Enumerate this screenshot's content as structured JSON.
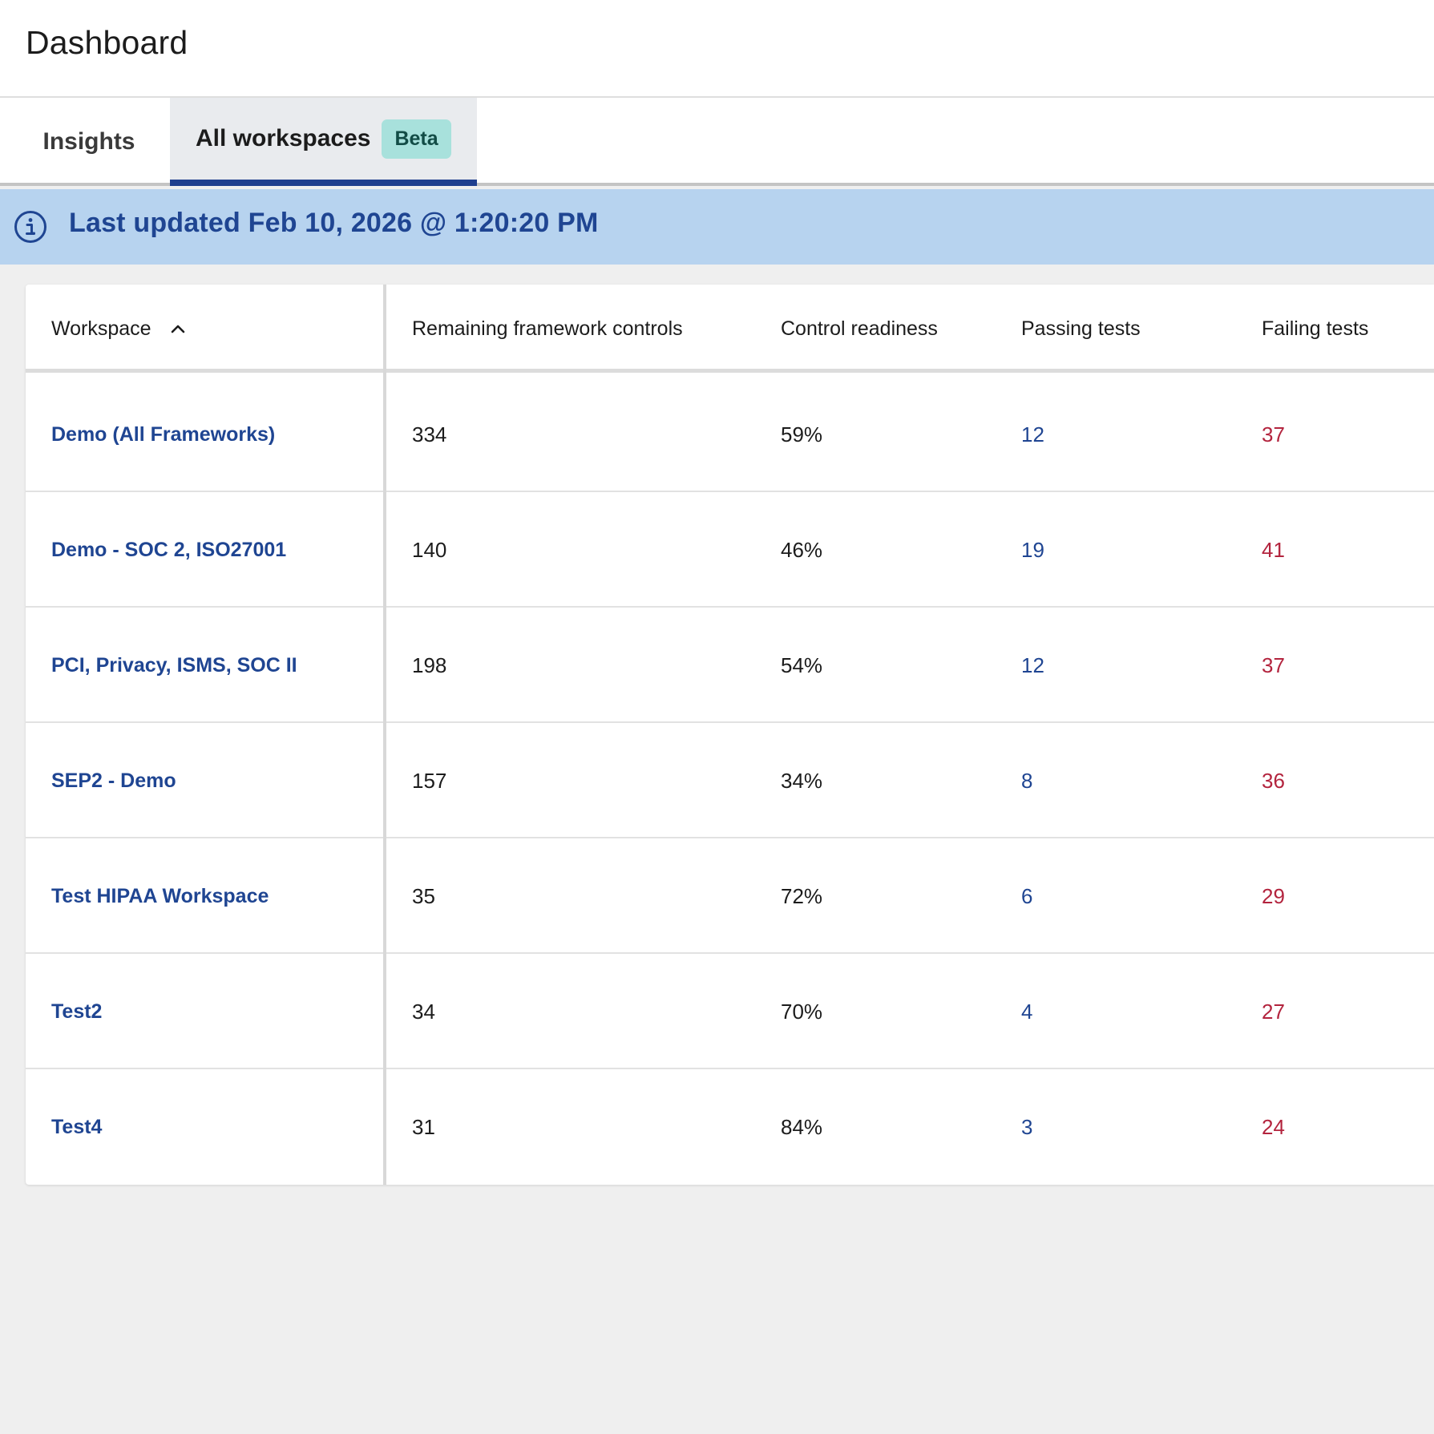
{
  "header": {
    "title": "Dashboard"
  },
  "tabs": [
    {
      "label": "Insights",
      "active": false
    },
    {
      "label": "All workspaces",
      "active": true,
      "badge": "Beta"
    }
  ],
  "banner": {
    "text": "Last updated Feb 10, 2026 @ 1:20:20 PM",
    "icon": "info-icon"
  },
  "table": {
    "columns": [
      "Workspace",
      "Remaining framework controls",
      "Control readiness",
      "Passing tests",
      "Failing tests"
    ],
    "sort": {
      "column": "Workspace",
      "direction": "ascending",
      "icon": "chevron-up-icon"
    },
    "rows": [
      {
        "workspace": "Demo (All Frameworks)",
        "remaining": "334",
        "readiness": "59%",
        "passing": "12",
        "failing": "37"
      },
      {
        "workspace": "Demo - SOC 2, ISO27001",
        "remaining": "140",
        "readiness": "46%",
        "passing": "19",
        "failing": "41"
      },
      {
        "workspace": "PCI, Privacy, ISMS, SOC II",
        "remaining": "198",
        "readiness": "54%",
        "passing": "12",
        "failing": "37"
      },
      {
        "workspace": "SEP2 - Demo",
        "remaining": "157",
        "readiness": "34%",
        "passing": "8",
        "failing": "36"
      },
      {
        "workspace": "Test HIPAA Workspace",
        "remaining": "35",
        "readiness": "72%",
        "passing": "6",
        "failing": "29"
      },
      {
        "workspace": "Test2",
        "remaining": "34",
        "readiness": "70%",
        "passing": "4",
        "failing": "27"
      },
      {
        "workspace": "Test4",
        "remaining": "31",
        "readiness": "84%",
        "passing": "3",
        "failing": "24"
      }
    ]
  },
  "colors": {
    "link": "#1f4592",
    "failing": "#b3243e",
    "banner_bg": "#b7d3ef",
    "badge_bg": "#a8e1dc",
    "active_tab_underline": "#1f3f8f"
  }
}
